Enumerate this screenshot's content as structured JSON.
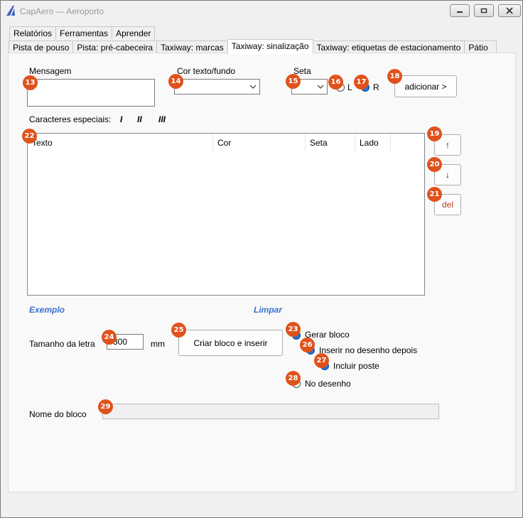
{
  "window": {
    "title": "CapAero — Aeroporto"
  },
  "tabs_row1": [
    "Relatórios",
    "Ferramentas",
    "Aprender"
  ],
  "tabs_row2": [
    "Pista de pouso",
    "Pista: pré-cabeceira",
    "Taxiway: marcas",
    "Taxiway: sinalização",
    "Taxiway: etiquetas de estacionamento",
    "Pátio"
  ],
  "active_tab": "Taxiway: sinalização",
  "form": {
    "mensagem_label": "Mensagem",
    "mensagem_value": "",
    "cor_label": "Cor texto/fundo",
    "cor_value": "",
    "seta_label": "Seta",
    "seta_value": "",
    "radio_l": "L",
    "radio_r": "R",
    "adicionar_button": "adicionar >",
    "caracteres_label": "Caracteres especiais:",
    "special_chars": [
      "I",
      "II",
      "III"
    ],
    "list_columns": [
      "Texto",
      "Cor",
      "Seta",
      "Lado"
    ],
    "up_button": "↑",
    "down_button": "↓",
    "del_button": "del",
    "exemplo_link": "Exemplo",
    "limpar_link": "Limpar",
    "tamanho_label": "Tamanho da letra",
    "tamanho_value": "300",
    "tamanho_unit": "mm",
    "criar_button": "Criar bloco e inserir",
    "gerar_bloco": "Gerar bloco",
    "inserir_depois": "Inserir no desenho depois",
    "incluir_poste": "Incluir poste",
    "no_desenho": "No desenho",
    "nome_bloco_label": "Nome do bloco",
    "nome_bloco_value": ""
  },
  "badges": {
    "b13": "13",
    "b14": "14",
    "b15": "15",
    "b16": "16",
    "b17": "17",
    "b18": "18",
    "b19": "19",
    "b20": "20",
    "b21": "21",
    "b22": "22",
    "b23": "23",
    "b24": "24",
    "b25": "25",
    "b26": "26",
    "b27": "27",
    "b28": "28",
    "b29": "29"
  },
  "colors": {
    "badge": "#e0521c",
    "link": "#3b6fd1",
    "radio_selected": "#2a6fd6",
    "del_text": "#c0392b"
  }
}
